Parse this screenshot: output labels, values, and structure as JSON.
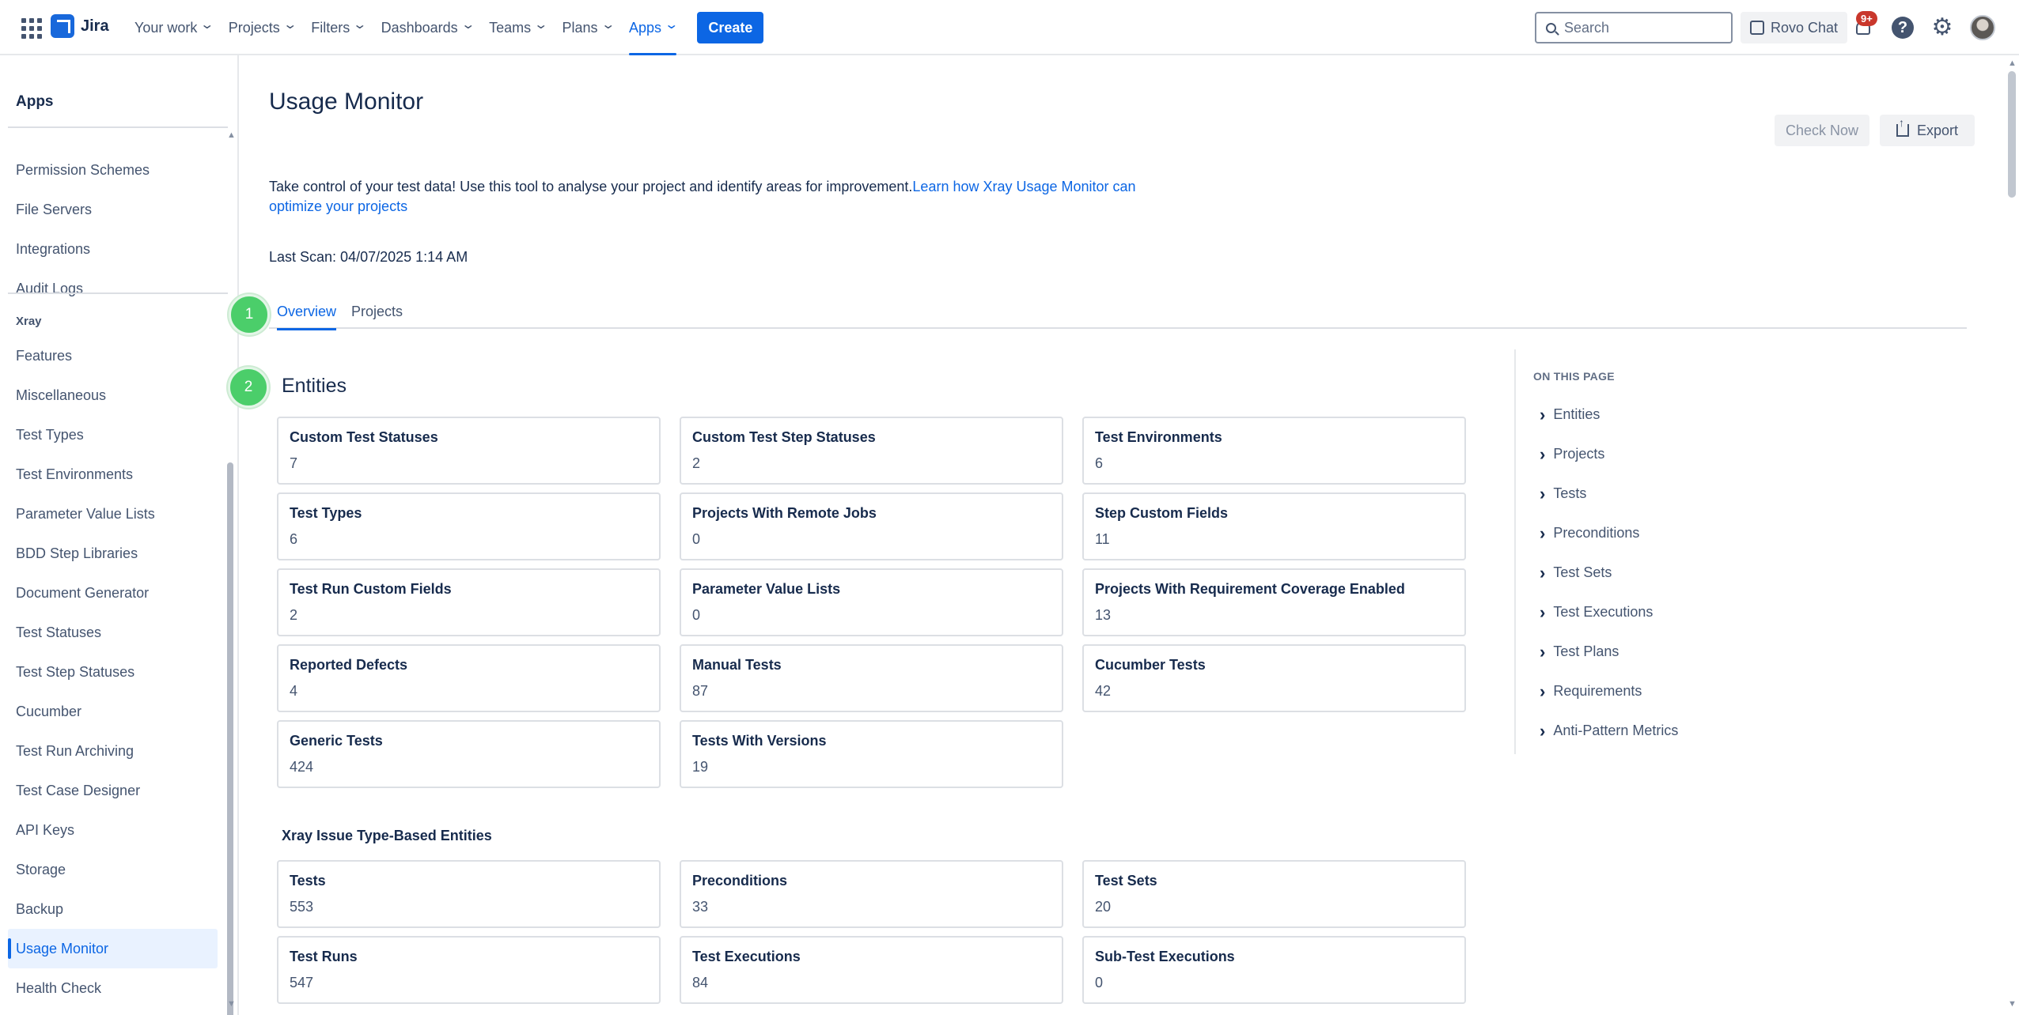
{
  "nav": {
    "brand": "Jira",
    "items": [
      {
        "label": "Your work",
        "active": false
      },
      {
        "label": "Projects",
        "active": false
      },
      {
        "label": "Filters",
        "active": false
      },
      {
        "label": "Dashboards",
        "active": false
      },
      {
        "label": "Teams",
        "active": false
      },
      {
        "label": "Plans",
        "active": false
      },
      {
        "label": "Apps",
        "active": true
      }
    ],
    "create_label": "Create",
    "search_placeholder": "Search",
    "rovo_label": "Rovo Chat",
    "notifications_badge": "9+"
  },
  "sidebar": {
    "heading": "Apps",
    "items_top": [
      "Permission Schemes",
      "File Servers",
      "Integrations",
      "Audit Logs"
    ],
    "section_label": "Xray",
    "items_xray": [
      "Features",
      "Miscellaneous",
      "Test Types",
      "Test Environments",
      "Parameter Value Lists",
      "BDD Step Libraries",
      "Document Generator",
      "Test Statuses",
      "Test Step Statuses",
      "Cucumber",
      "Test Run Archiving",
      "Test Case Designer",
      "API Keys",
      "Storage",
      "Backup",
      "Usage Monitor",
      "Health Check"
    ],
    "selected": "Usage Monitor"
  },
  "main": {
    "title": "Usage Monitor",
    "check_now_label": "Check Now",
    "export_label": "Export",
    "intro_text": "Take control of your test data! Use this tool to analyse your project and identify areas for improvement.",
    "intro_link": "Learn how Xray Usage Monitor can optimize your projects",
    "last_scan": "Last Scan: 04/07/2025 1:14 AM",
    "tabs": [
      "Overview",
      "Projects"
    ],
    "step1": "1",
    "step2": "2",
    "entities_title": "Entities",
    "entities": [
      {
        "label": "Custom Test Statuses",
        "value": "7"
      },
      {
        "label": "Custom Test Step Statuses",
        "value": "2"
      },
      {
        "label": "Test Environments",
        "value": "6"
      },
      {
        "label": "Test Types",
        "value": "6"
      },
      {
        "label": "Projects With Remote Jobs",
        "value": "0"
      },
      {
        "label": "Step Custom Fields",
        "value": "11"
      },
      {
        "label": "Test Run Custom Fields",
        "value": "2"
      },
      {
        "label": "Parameter Value Lists",
        "value": "0"
      },
      {
        "label": "Projects With Requirement Coverage Enabled",
        "value": "13"
      },
      {
        "label": "Reported Defects",
        "value": "4"
      },
      {
        "label": "Manual Tests",
        "value": "87"
      },
      {
        "label": "Cucumber Tests",
        "value": "42"
      },
      {
        "label": "Generic Tests",
        "value": "424"
      },
      {
        "label": "Tests With Versions",
        "value": "19"
      }
    ],
    "issue_entities_title": "Xray Issue Type-Based Entities",
    "issue_entities": [
      {
        "label": "Tests",
        "value": "553"
      },
      {
        "label": "Preconditions",
        "value": "33"
      },
      {
        "label": "Test Sets",
        "value": "20"
      },
      {
        "label": "Test Runs",
        "value": "547"
      },
      {
        "label": "Test Executions",
        "value": "84"
      },
      {
        "label": "Sub-Test Executions",
        "value": "0"
      }
    ]
  },
  "on_this_page": {
    "heading": "ON THIS PAGE",
    "items": [
      "Entities",
      "Projects",
      "Tests",
      "Preconditions",
      "Test Sets",
      "Test Executions",
      "Test Plans",
      "Requirements",
      "Anti-Pattern Metrics"
    ]
  }
}
